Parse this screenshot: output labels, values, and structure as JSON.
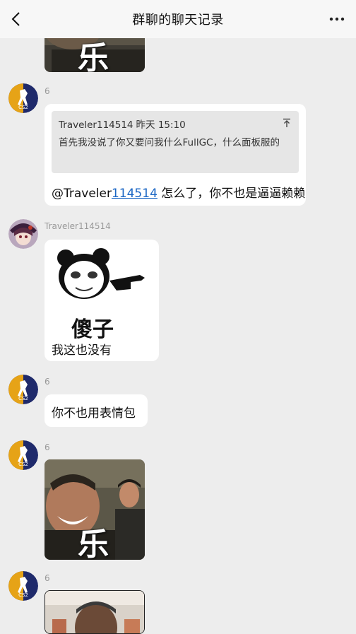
{
  "header": {
    "title": "群聊的聊天记录",
    "back_icon": "chevron-left-icon",
    "more_icon": "more-horizontal-icon"
  },
  "messages": [
    {
      "type": "image-sticker",
      "caption": "乐"
    },
    {
      "sender": "6",
      "quote": {
        "author": "Traveler114514",
        "time": "昨天 15:10",
        "text": "首先我没说了你又要问我什么FullGC，什么面板服的",
        "icon": "scroll-to-top-icon"
      },
      "text_prefix": "@Traveler",
      "text_mention": "114514",
      "text_suffix": " 怎么了，你不也是逼逼赖赖"
    },
    {
      "sender": "Traveler114514",
      "sticker_caption": "傻子",
      "text": "我这也没有"
    },
    {
      "sender": "6",
      "text": "你不也用表情包"
    },
    {
      "sender": "6",
      "type": "image-sticker",
      "caption": "乐"
    },
    {
      "sender": "6",
      "type": "image-sticker"
    }
  ]
}
